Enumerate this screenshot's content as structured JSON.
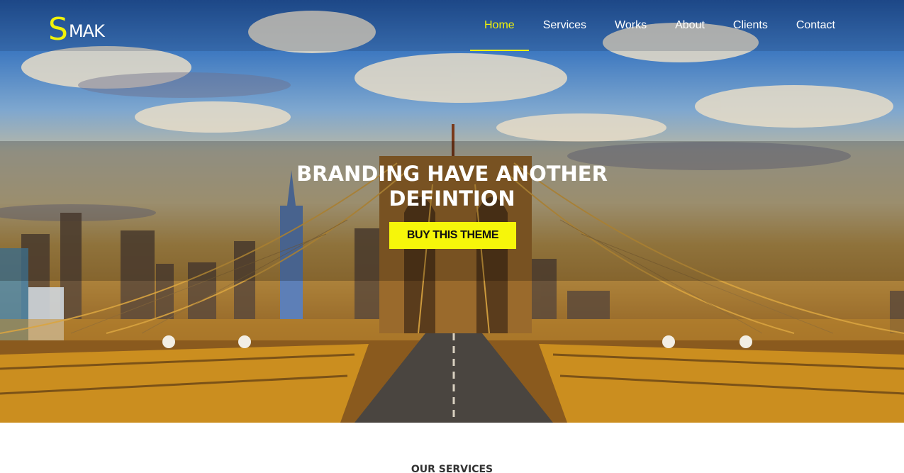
{
  "brand": {
    "initial": "S",
    "rest": "MAK"
  },
  "nav": {
    "items": [
      {
        "label": "Home",
        "active": true
      },
      {
        "label": "Services",
        "active": false
      },
      {
        "label": "Works",
        "active": false
      },
      {
        "label": "About",
        "active": false
      },
      {
        "label": "Clients",
        "active": false
      },
      {
        "label": "Contact",
        "active": false
      }
    ]
  },
  "hero": {
    "title_line1": "BRANDING HAVE ANOTHER",
    "title_line2": "DEFINTION",
    "cta_label": "BUY THIS THEME"
  },
  "services": {
    "heading": "OUR SERVICES"
  },
  "colors": {
    "accent": "#f0f20a",
    "cta_bg": "#f6f60a",
    "nav_text": "#ffffff"
  }
}
